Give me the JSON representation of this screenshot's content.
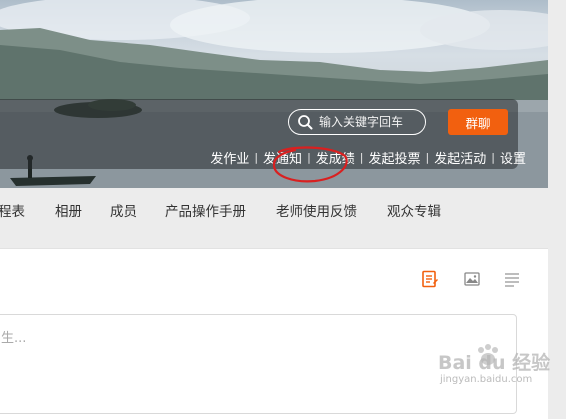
{
  "header": {
    "search": {
      "placeholder": "输入关键字回车"
    },
    "group_chat_label": "群聊",
    "actions": [
      "发作业",
      "发通知",
      "发成绩",
      "发起投票",
      "发起活动",
      "设置"
    ],
    "separator": "|"
  },
  "tabs": [
    "程表",
    "相册",
    "成员",
    "产品操作手册",
    "老师使用反馈",
    "观众专辑"
  ],
  "editor": {
    "placeholder": "生...",
    "tools": [
      "edit-icon",
      "image-icon",
      "list-icon"
    ]
  },
  "watermark": {
    "brand": "Bai du 经验",
    "url": "jingyan.baidu.com"
  },
  "colors": {
    "accent": "#f2600f",
    "annotation": "#d92020"
  }
}
